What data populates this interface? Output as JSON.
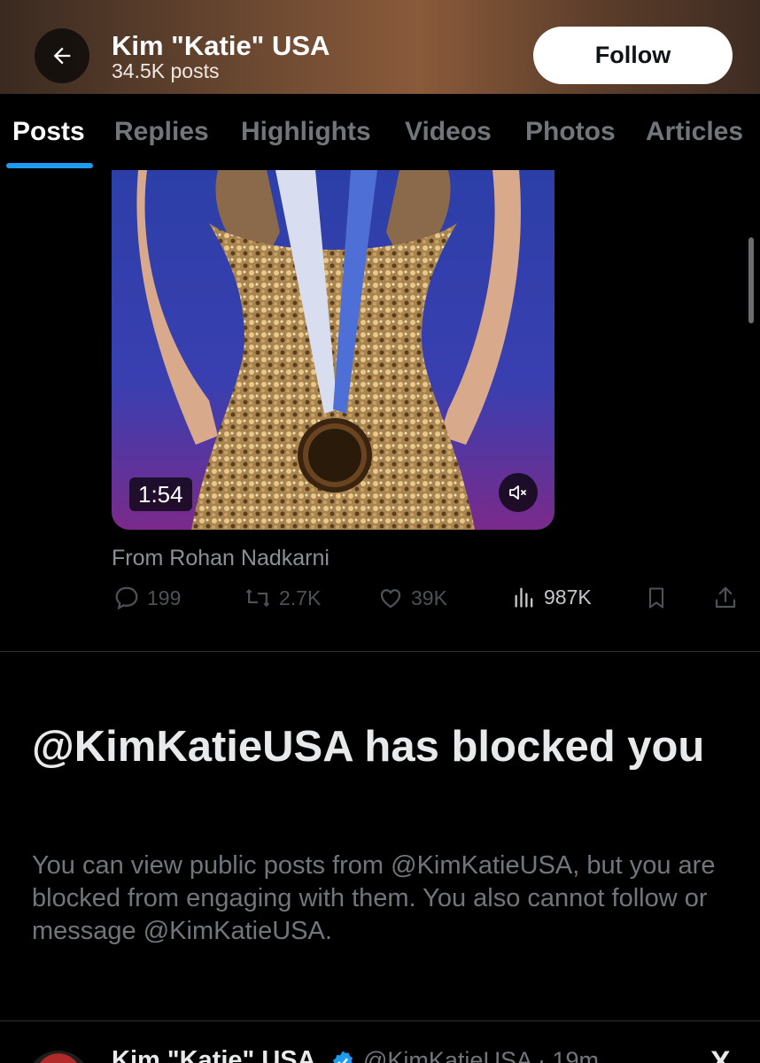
{
  "header": {
    "title": "Kim \"Katie\" USA",
    "subtitle": "34.5K posts",
    "back_icon": "arrow-left-icon",
    "follow_label": "Follow"
  },
  "tabs": [
    {
      "label": "Posts",
      "active": true
    },
    {
      "label": "Replies",
      "active": false
    },
    {
      "label": "Highlights",
      "active": false
    },
    {
      "label": "Videos",
      "active": false
    },
    {
      "label": "Photos",
      "active": false
    },
    {
      "label": "Articles",
      "active": false
    }
  ],
  "post": {
    "video_duration": "1:54",
    "mute_icon": "speaker-muted-icon",
    "attribution": "From Rohan Nadkarni",
    "actions": {
      "replies": "199",
      "reposts": "2.7K",
      "likes": "39K",
      "views": "987K"
    }
  },
  "blocked_notice": {
    "title": "@KimKatieUSA has blocked you",
    "description": "You can view public posts from @KimKatieUSA, but you are blocked from engaging with them. You also cannot follow or message @KimKatieUSA."
  },
  "next_post": {
    "name": "Kim \"Katie\" USA",
    "handle_time": "@KimKatieUSA · 19m"
  },
  "colors": {
    "accent": "#1d9bf0",
    "background": "#000000",
    "muted_text": "#71767b"
  }
}
